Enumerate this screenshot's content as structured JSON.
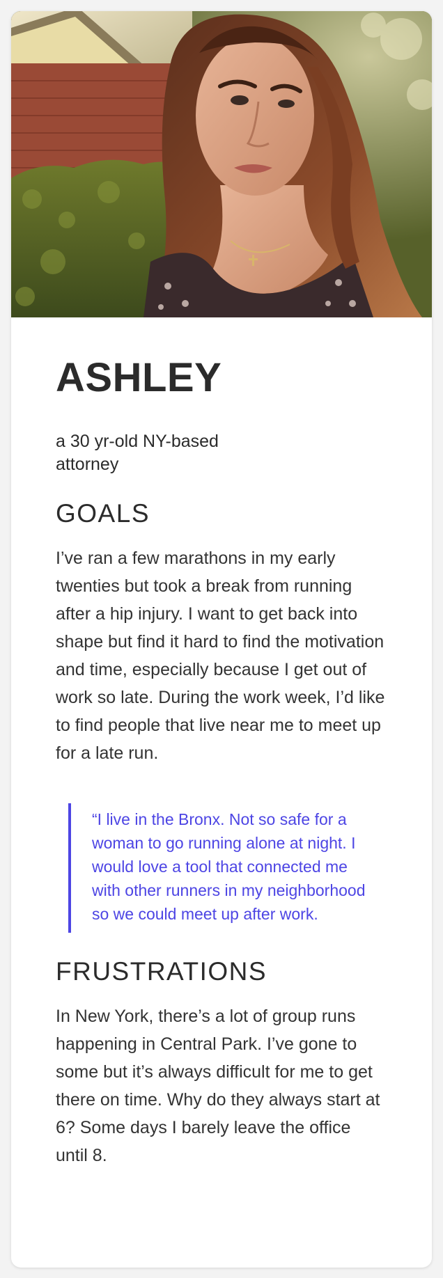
{
  "persona": {
    "photo_alt": "portrait",
    "name": "ASHLEY",
    "subtitle": "a 30 yr-old NY-based attorney"
  },
  "goals": {
    "title": "GOALS",
    "text": "I’ve ran a few marathons in my early twenties but took a break from running after a hip injury. I want to get back into shape but find it hard to find the motivation and time, especially because I get out of work so late. During the work week, I’d like to find people that live near me to meet up for a late run."
  },
  "quote": {
    "text": "“I live in the Bronx. Not so safe for a woman to go running alone at night. I would love a tool that connected me with other runners in my neighborhood so we could meet up after work."
  },
  "frustrations": {
    "title": "FRUSTRATIONS",
    "text": "In New York, there’s a lot of group runs happening in Central Park. I’ve gone to some but it’s always difficult for me to get there on time. Why do they always start at 6? Some days I barely leave the office until 8."
  },
  "colors": {
    "accent": "#4d45e4",
    "text": "#2b2b2b",
    "card_background": "#ffffff",
    "page_background": "#f3f3f3"
  }
}
